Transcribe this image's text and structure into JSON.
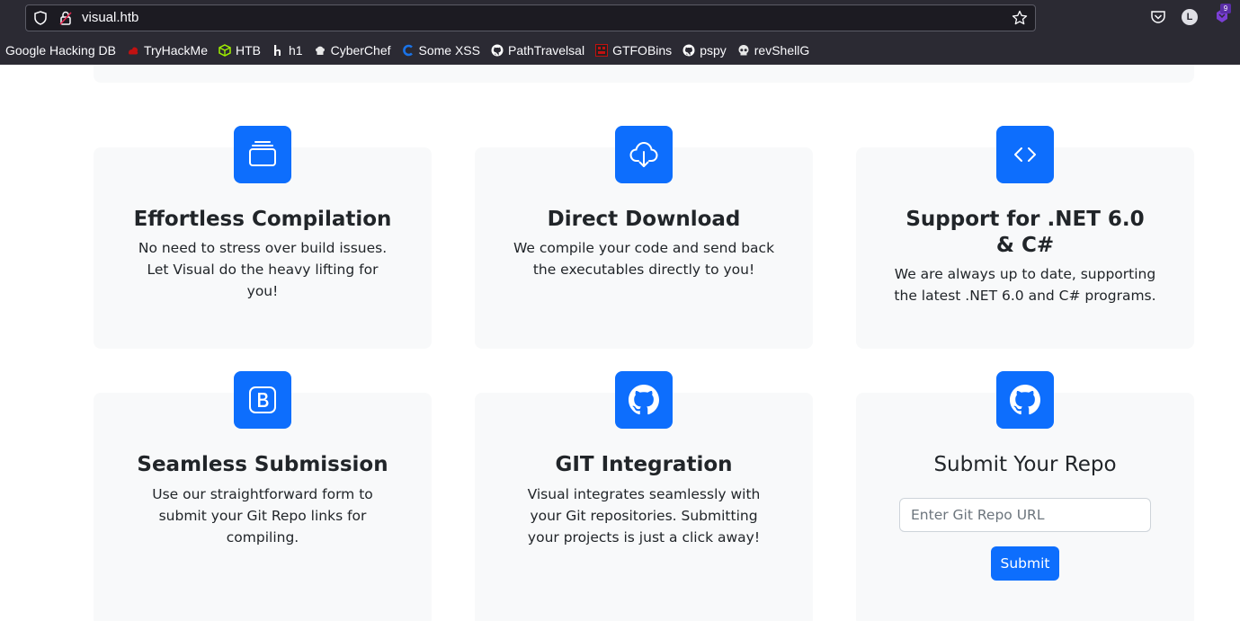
{
  "browser": {
    "url": "visual.htb",
    "extension_badge": "9",
    "account_initial": "L",
    "bookmarks": [
      {
        "label": "Google Hacking DB",
        "icon": "none",
        "color": "#fbfbfe"
      },
      {
        "label": "TryHackMe",
        "icon": "tryhackme-icon",
        "color": "#c11111"
      },
      {
        "label": "HTB",
        "icon": "htb-cube-icon",
        "color": "#9fef00"
      },
      {
        "label": "h1",
        "icon": "hackerone-icon",
        "color": "#ffffff"
      },
      {
        "label": "CyberChef",
        "icon": "chef-hat-icon",
        "color": "#ffffff"
      },
      {
        "label": "Some XSS",
        "icon": "xss-icon",
        "color": "#1a73e8"
      },
      {
        "label": "PathTravelsal",
        "icon": "github-icon",
        "color": "#ffffff"
      },
      {
        "label": "GTFOBins",
        "icon": "gtfobins-icon",
        "color": "#c11111"
      },
      {
        "label": "pspy",
        "icon": "github-icon",
        "color": "#ffffff"
      },
      {
        "label": "revShellG",
        "icon": "skull-icon",
        "color": "#ffffff"
      }
    ]
  },
  "features": [
    {
      "title": "Effortless Compilation",
      "text": "No need to stress over build issues. Let Visual do the heavy lifting for you!",
      "icon": "collection-icon"
    },
    {
      "title": "Direct Download",
      "text": "We compile your code and send back the executables directly to you!",
      "icon": "cloud-download-icon"
    },
    {
      "title": "Support for .NET 6.0 & C#",
      "text": "We are always up to date, supporting the latest .NET 6.0 and C# programs.",
      "icon": "code-icon"
    },
    {
      "title": "Seamless Submission",
      "text": "Use our straightforward form to submit your Git Repo links for compiling.",
      "icon": "bootstrap-icon"
    },
    {
      "title": "GIT Integration",
      "text": "Visual integrates seamlessly with your Git repositories. Submitting your projects is just a click away!",
      "icon": "github-icon"
    }
  ],
  "submit_form": {
    "title": "Submit Your Repo",
    "placeholder": "Enter Git Repo URL",
    "button_label": "Submit",
    "icon": "github-icon"
  },
  "colors": {
    "accent": "#0d6efd",
    "card_bg": "#f8f9fa",
    "chrome_bg": "#2b2a33"
  }
}
